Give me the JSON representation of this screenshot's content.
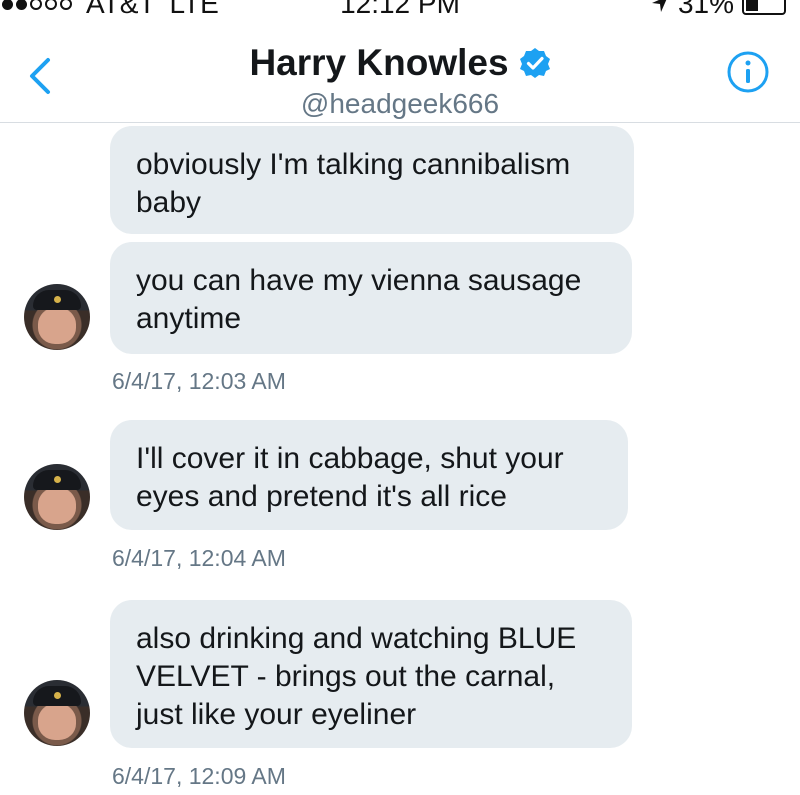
{
  "status_bar": {
    "carrier": "AT&T",
    "network": "LTE",
    "time": "12:12 PM",
    "battery": "31%"
  },
  "nav": {
    "title": "Harry Knowles",
    "handle": "@headgeek666"
  },
  "messages": [
    {
      "text": "obviously I'm talking cannibalism baby"
    },
    {
      "text": "you can have my vienna sausage anytime"
    },
    {
      "timestamp": "6/4/17, 12:03 AM"
    },
    {
      "text": "I'll cover it in cabbage, shut your eyes and pretend it's all rice"
    },
    {
      "timestamp": "6/4/17, 12:04 AM"
    },
    {
      "text": "also drinking and watching BLUE VELVET - brings out the carnal, just like your eyeliner"
    },
    {
      "timestamp": "6/4/17, 12:09 AM"
    }
  ],
  "colors": {
    "accent": "#1da1f2",
    "bubble": "#e6ecf0",
    "muted_text": "#657786"
  }
}
